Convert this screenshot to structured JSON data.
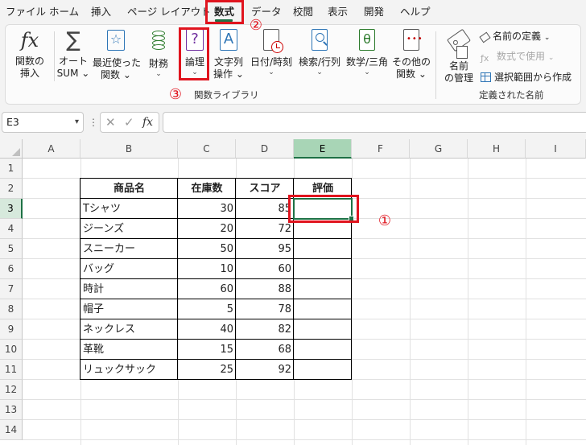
{
  "tabs": [
    "ファイル",
    "ホーム",
    "挿入",
    "ページ レイアウト",
    "数式",
    "データ",
    "校閲",
    "表示",
    "開発",
    "ヘルプ"
  ],
  "active_tab": "数式",
  "ribbon": {
    "insert_function": [
      "関数の",
      "挿入"
    ],
    "autosum": [
      "オート",
      "SUM"
    ],
    "recent": [
      "最近使った",
      "関数"
    ],
    "financial": "財務",
    "logical": "論理",
    "text": [
      "文字列",
      "操作"
    ],
    "datetime": "日付/時刻",
    "lookup": "検索/行列",
    "math": "数学/三角",
    "more": [
      "その他の",
      "関数"
    ],
    "library_label": "関数ライブラリ",
    "name_manager": [
      "名前",
      "の管理"
    ],
    "define_name": "名前の定義",
    "use_in_formula": "数式で使用",
    "create_from_selection": "選択範囲から作成",
    "names_label": "定義された名前",
    "chevron": "⌄"
  },
  "formula_bar": {
    "name_box": "E3",
    "more": "⋮",
    "cancel": "✕",
    "enter": "✓",
    "fx": "fx",
    "formula": ""
  },
  "sheet": {
    "columns": [
      "A",
      "B",
      "C",
      "D",
      "E",
      "F",
      "G",
      "H",
      "I"
    ],
    "rows": [
      "1",
      "2",
      "3",
      "4",
      "5",
      "6",
      "7",
      "8",
      "9",
      "10",
      "11",
      "12",
      "13",
      "14"
    ],
    "selected_cell": "E3",
    "table_headers": [
      "商品名",
      "在庫数",
      "スコア",
      "評価"
    ],
    "table_rows": [
      {
        "name": "Tシャツ",
        "stock": "30",
        "score": "85",
        "rating": ""
      },
      {
        "name": "ジーンズ",
        "stock": "20",
        "score": "72",
        "rating": ""
      },
      {
        "name": "スニーカー",
        "stock": "50",
        "score": "95",
        "rating": ""
      },
      {
        "name": "バッグ",
        "stock": "10",
        "score": "60",
        "rating": ""
      },
      {
        "name": "時計",
        "stock": "60",
        "score": "88",
        "rating": ""
      },
      {
        "name": "帽子",
        "stock": "5",
        "score": "78",
        "rating": ""
      },
      {
        "name": "ネックレス",
        "stock": "40",
        "score": "82",
        "rating": ""
      },
      {
        "name": "革靴",
        "stock": "15",
        "score": "68",
        "rating": ""
      },
      {
        "name": "リュックサック",
        "stock": "25",
        "score": "92",
        "rating": ""
      }
    ]
  },
  "annotations": [
    "①",
    "②",
    "③"
  ],
  "colors": {
    "accent_green": "#1e7145",
    "selected_col_header": "#a8d5b6",
    "annotation_red": "#e0141e"
  }
}
